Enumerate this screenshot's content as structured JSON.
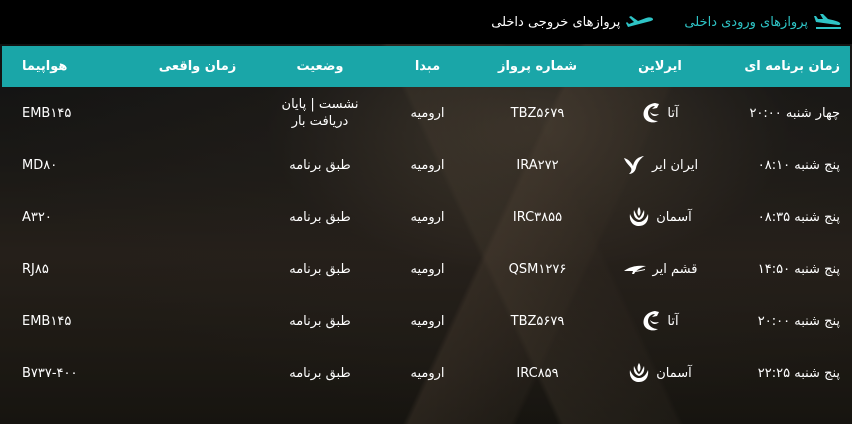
{
  "tabs": [
    {
      "label": "پروازهای ورودی داخلی",
      "active": true
    },
    {
      "label": "پروازهای خروجی داخلی",
      "active": false
    }
  ],
  "colors": {
    "accent": "#1aa6a8",
    "active_tab": "#2ec4c6"
  },
  "headers": {
    "time": "زمان برنامه ای",
    "airline": "ایرلاین",
    "flight": "شماره پرواز",
    "origin": "مبدا",
    "status": "وضعیت",
    "actual": "زمان واقعی",
    "aircraft": "هواپیما"
  },
  "rows": [
    {
      "time": "چهار شنبه ۲۰:۰۰",
      "airline": "آتا",
      "airline_icon": "ata-logo-icon",
      "flight": "TBZ۵۶۷۹",
      "origin": "ارومیه",
      "status_line1": "نشست | پایان",
      "status_line2": "دریافت بار",
      "actual": "",
      "aircraft": "EMB۱۴۵"
    },
    {
      "time": "پنج شنبه ۰۸:۱۰",
      "airline": "ایران ایر",
      "airline_icon": "iranair-logo-icon",
      "flight": "IRA۲۷۲",
      "origin": "ارومیه",
      "status_line1": "طبق برنامه",
      "status_line2": "",
      "actual": "",
      "aircraft": "MD۸۰"
    },
    {
      "time": "پنج شنبه ۰۸:۳۵",
      "airline": "آسمان",
      "airline_icon": "aseman-logo-icon",
      "flight": "IRC۳۸۵۵",
      "origin": "ارومیه",
      "status_line1": "طبق برنامه",
      "status_line2": "",
      "actual": "",
      "aircraft": "A۳۲۰"
    },
    {
      "time": "پنج شنبه ۱۴:۵۰",
      "airline": "قشم ایر",
      "airline_icon": "qeshmair-logo-icon",
      "flight": "QSM۱۲۷۶",
      "origin": "ارومیه",
      "status_line1": "طبق برنامه",
      "status_line2": "",
      "actual": "",
      "aircraft": "RJ۸۵"
    },
    {
      "time": "پنج شنبه ۲۰:۰۰",
      "airline": "آتا",
      "airline_icon": "ata-logo-icon",
      "flight": "TBZ۵۶۷۹",
      "origin": "ارومیه",
      "status_line1": "طبق برنامه",
      "status_line2": "",
      "actual": "",
      "aircraft": "EMB۱۴۵"
    },
    {
      "time": "پنج شنبه ۲۲:۲۵",
      "airline": "آسمان",
      "airline_icon": "aseman-logo-icon",
      "flight": "IRC۸۵۹",
      "origin": "ارومیه",
      "status_line1": "طبق برنامه",
      "status_line2": "",
      "actual": "",
      "aircraft": "B۷۳۷-۴۰۰"
    }
  ]
}
